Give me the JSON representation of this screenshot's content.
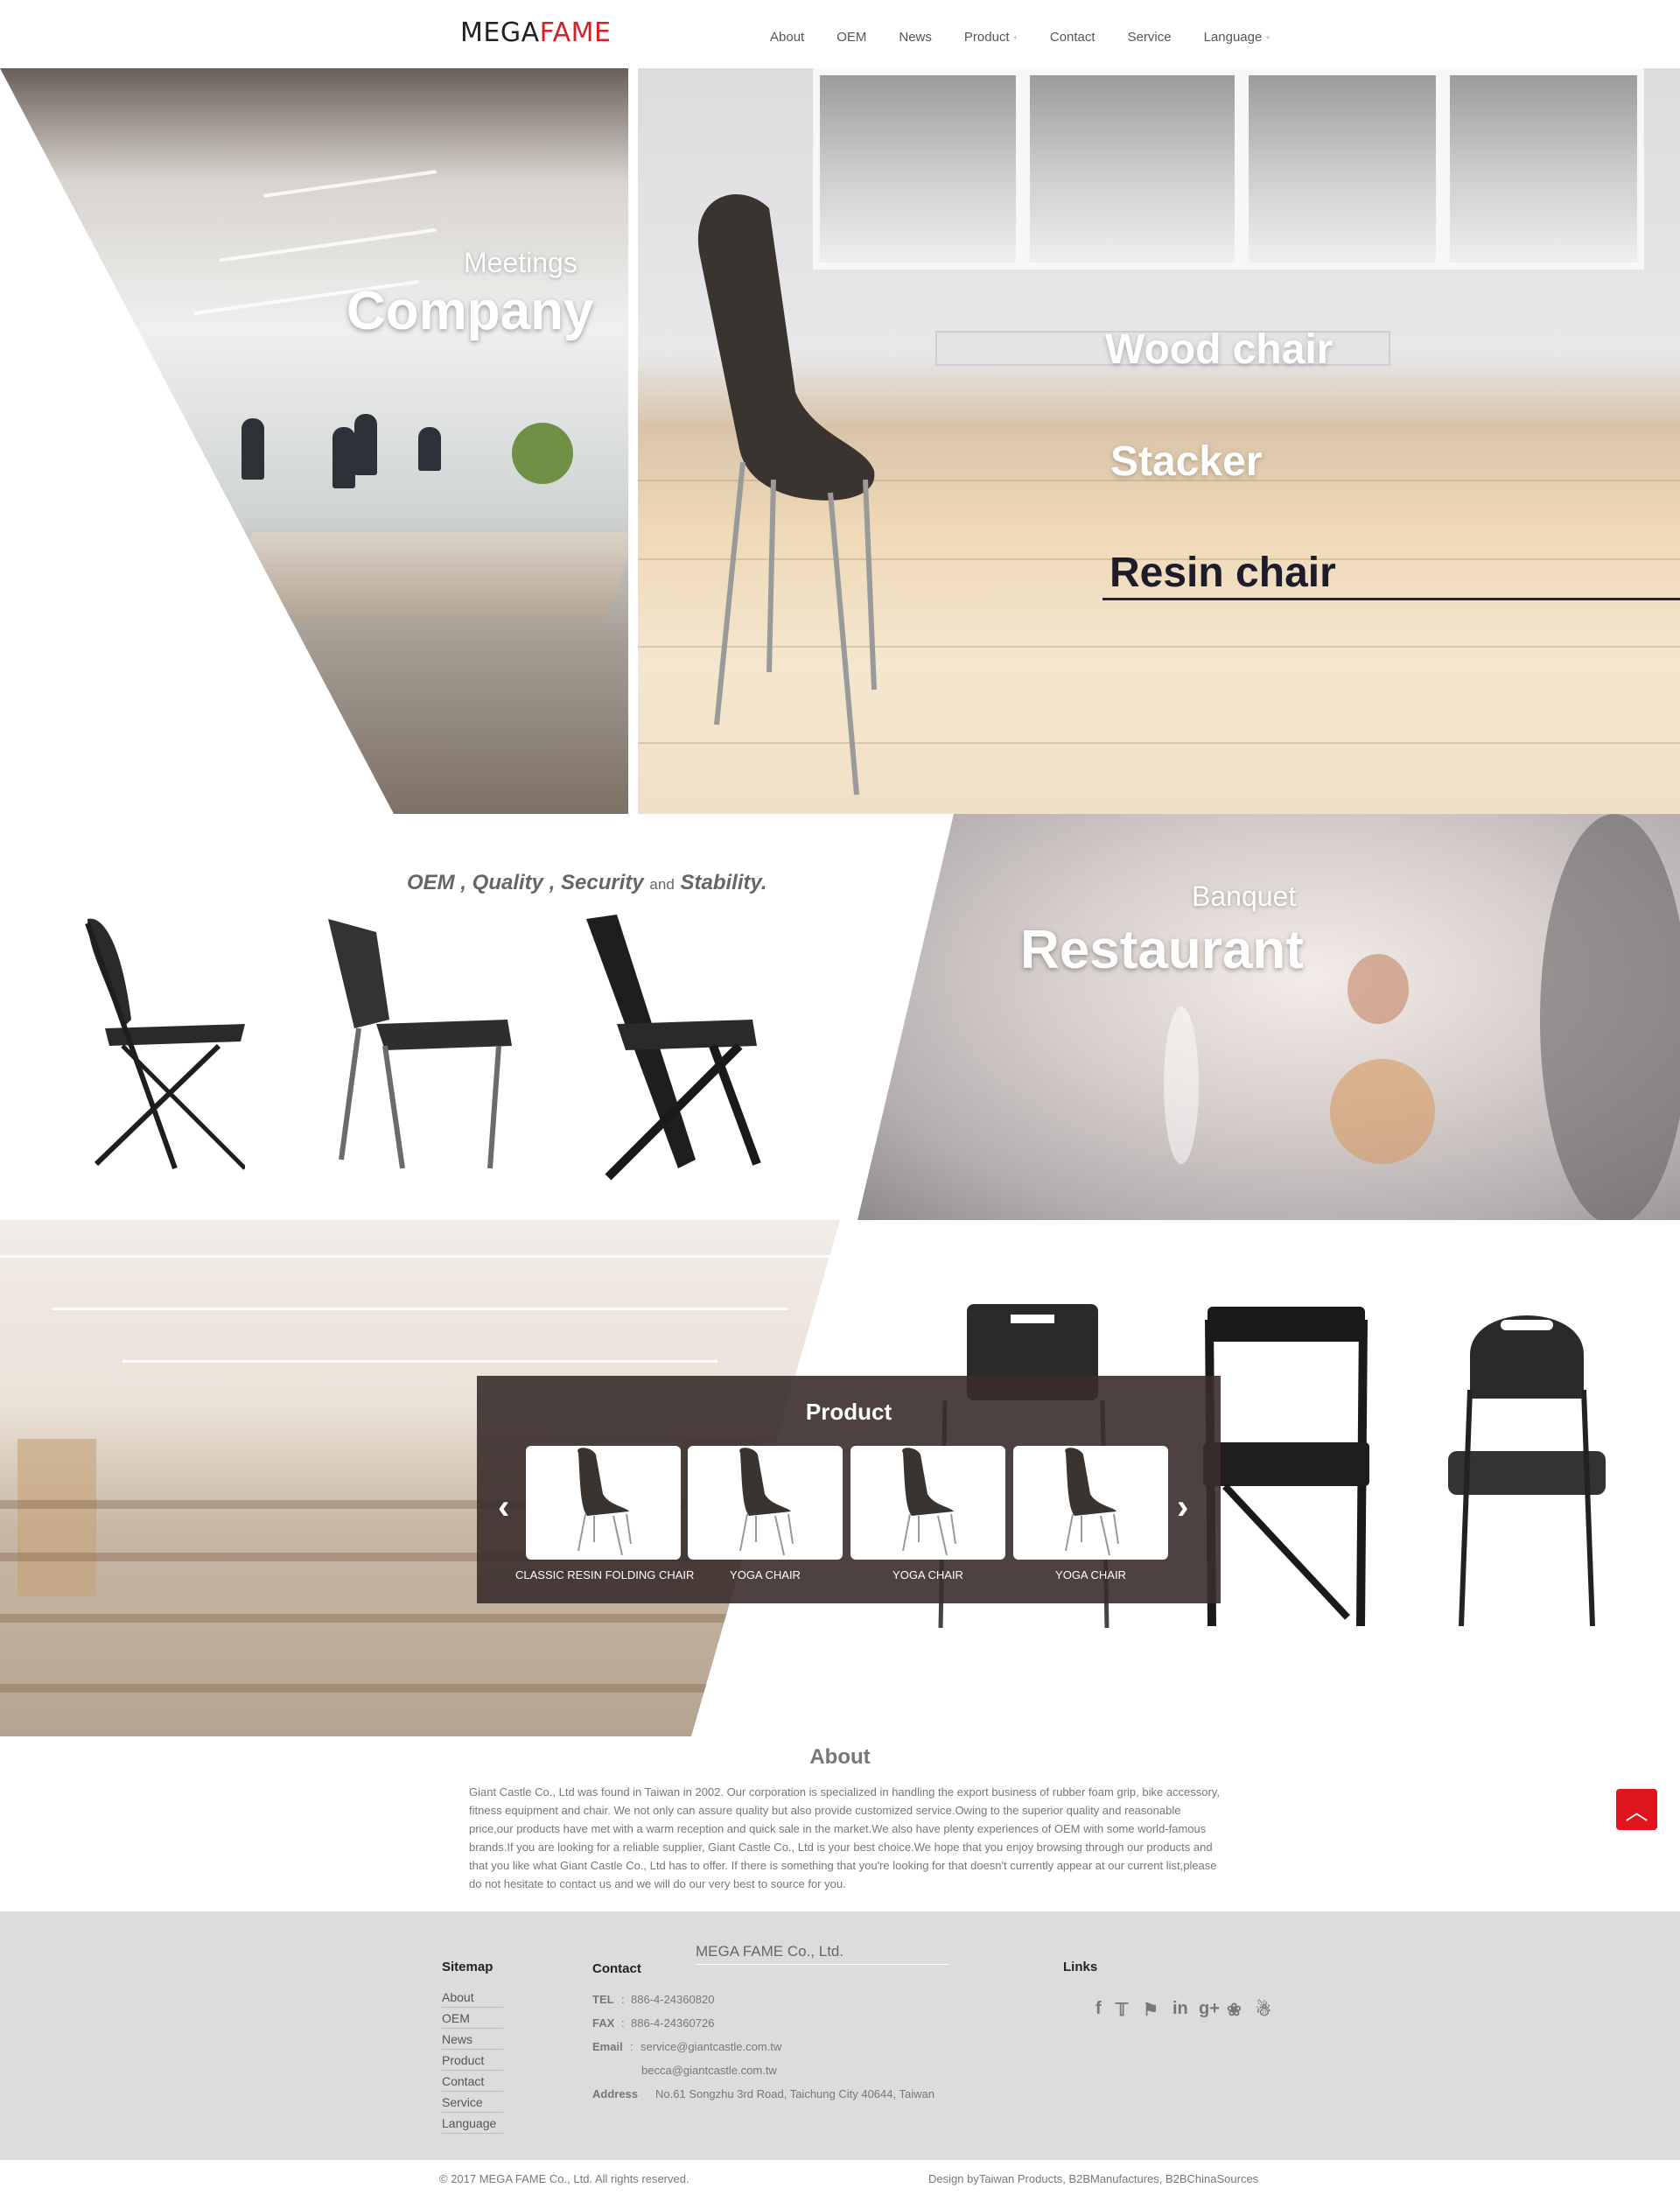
{
  "header": {
    "logo_mega": "MEGA",
    "logo_fame": "FAME",
    "nav": [
      {
        "label": "About"
      },
      {
        "label": "OEM"
      },
      {
        "label": "News"
      },
      {
        "label": "Product",
        "dropdown": true
      },
      {
        "label": "Contact"
      },
      {
        "label": "Service"
      },
      {
        "label": "Language",
        "dropdown": true
      }
    ]
  },
  "hero": {
    "left_small": "Meetings",
    "left_big": "Company",
    "menu": [
      "Wood chair",
      "Stacker",
      "Resin chair"
    ],
    "active_menu": "Resin chair"
  },
  "section2": {
    "tagline_parts": [
      "OEM , Quality , Security",
      "and",
      "Stability."
    ],
    "restaurant_small": "Banquet",
    "restaurant_big": "Restaurant"
  },
  "products": {
    "title": "Product",
    "prev_icon": "chevron-left-icon",
    "next_icon": "chevron-right-icon",
    "items": [
      {
        "label": "CLASSIC RESIN FOLDING CHAIR"
      },
      {
        "label": "YOGA CHAIR"
      },
      {
        "label": "YOGA CHAIR"
      },
      {
        "label": "YOGA CHAIR"
      }
    ]
  },
  "about": {
    "title": "About",
    "text": "Giant Castle Co., Ltd was found in Taiwan in 2002. Our corporation is specialized in handling the export business of rubber foam grip, bike accessory, fitness equipment and chair. We not only can assure quality but also provide customized service.Owing to the superior quality and reasonable price,our products have met with a warm reception and quick sale in the market.We also have plenty experiences of OEM with some world-famous brands.If you are looking for a reliable supplier, Giant Castle Co., Ltd is your best choice.We hope that you enjoy browsing through our products and that you like what Giant Castle Co., Ltd has to offer.  If there is something that you're looking for that doesn't currently appear at our current list,please do not hesitate to contact us and we will do our very best to source for you."
  },
  "footer": {
    "sitemap_title": "Sitemap",
    "sitemap": [
      "About",
      "OEM",
      "News",
      "Product",
      "Contact",
      "Service",
      "Language"
    ],
    "contact_title": "Contact",
    "company": "MEGA FAME Co., Ltd.",
    "tel_label": "TEL",
    "tel": "886-4-24360820",
    "fax_label": "FAX",
    "fax": "886-4-24360726",
    "email_label": "Email",
    "email1": "service@giantcastle.com.tw",
    "email2": "becca@giantcastle.com.tw",
    "address_label": "Address",
    "address": "No.61 Songzhu 3rd Road, Taichung City 40644, Taiwan",
    "links_title": "Links",
    "social": [
      "facebook-icon",
      "twitter-icon",
      "plurk-icon",
      "linkedin-icon",
      "google-plus-icon",
      "paw-icon",
      "qq-icon"
    ],
    "copyright": "© 2017 MEGA FAME Co., Ltd. All rights reserved.",
    "design_prefix": "Design by",
    "design_links": "Taiwan Products, B2BManufactures, B2BChinaSources"
  },
  "colors": {
    "brand_red": "#d42027",
    "product_box": "#3a2e2c",
    "footer_bg": "#dcdcdc",
    "underline": "#1c2448"
  }
}
